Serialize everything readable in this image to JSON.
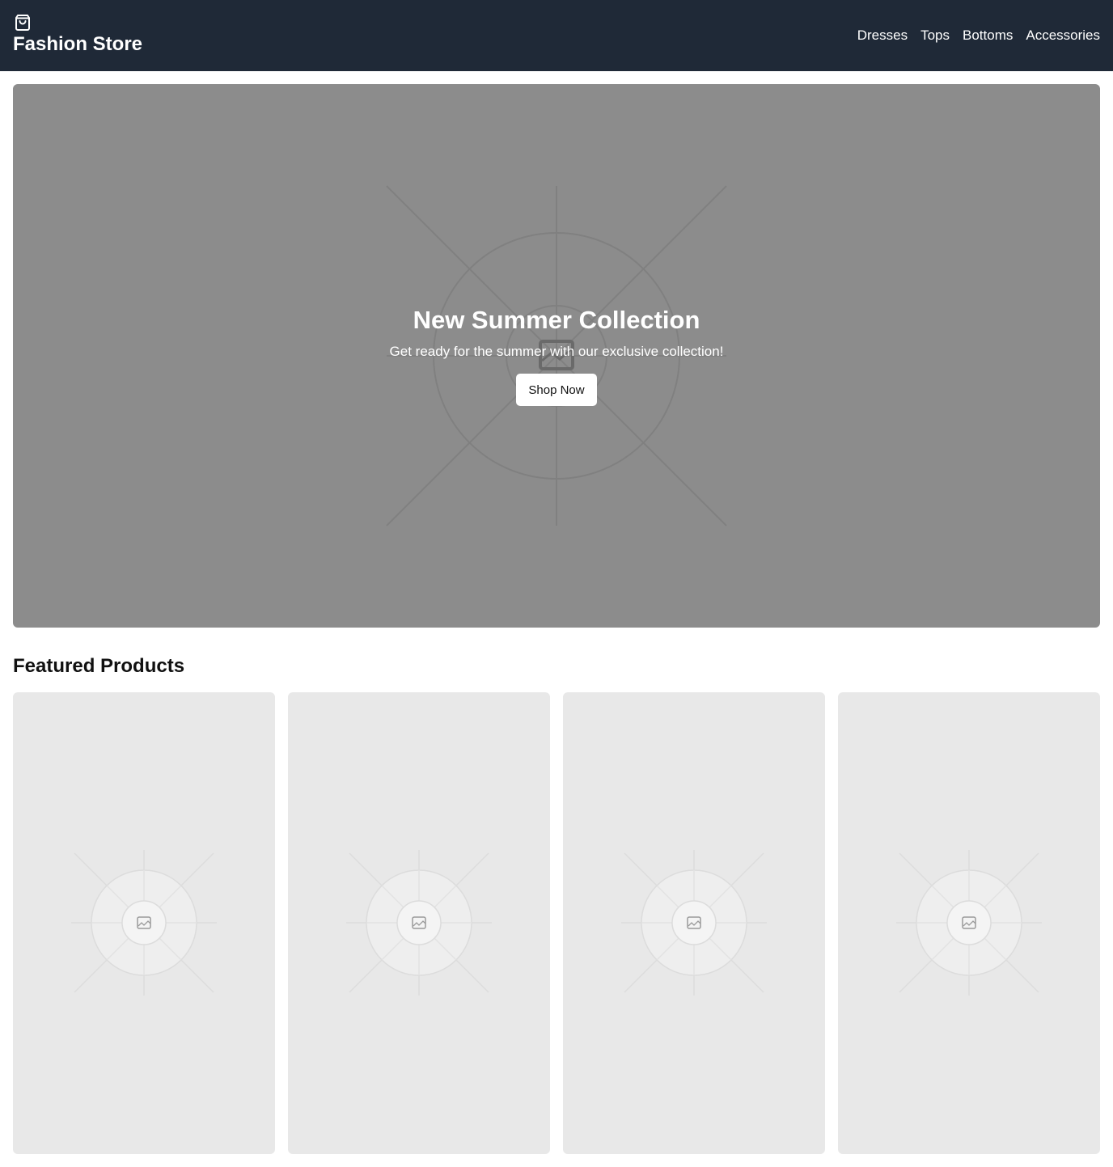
{
  "header": {
    "logo_icon": "shopping-bag-icon",
    "title": "Fashion Store",
    "nav": [
      "Dresses",
      "Tops",
      "Bottoms",
      "Accessories"
    ],
    "background": "#1f2937"
  },
  "hero": {
    "title": "New Summer Collection",
    "subtitle": "Get ready for the summer with our exclusive collection!",
    "button_label": "Shop Now",
    "image_icon": "image-placeholder-icon",
    "background": "#8c8c8c"
  },
  "featured": {
    "title": "Featured Products",
    "products": [
      {
        "image_icon": "image-placeholder-icon"
      },
      {
        "image_icon": "image-placeholder-icon"
      },
      {
        "image_icon": "image-placeholder-icon"
      },
      {
        "image_icon": "image-placeholder-icon"
      }
    ]
  }
}
